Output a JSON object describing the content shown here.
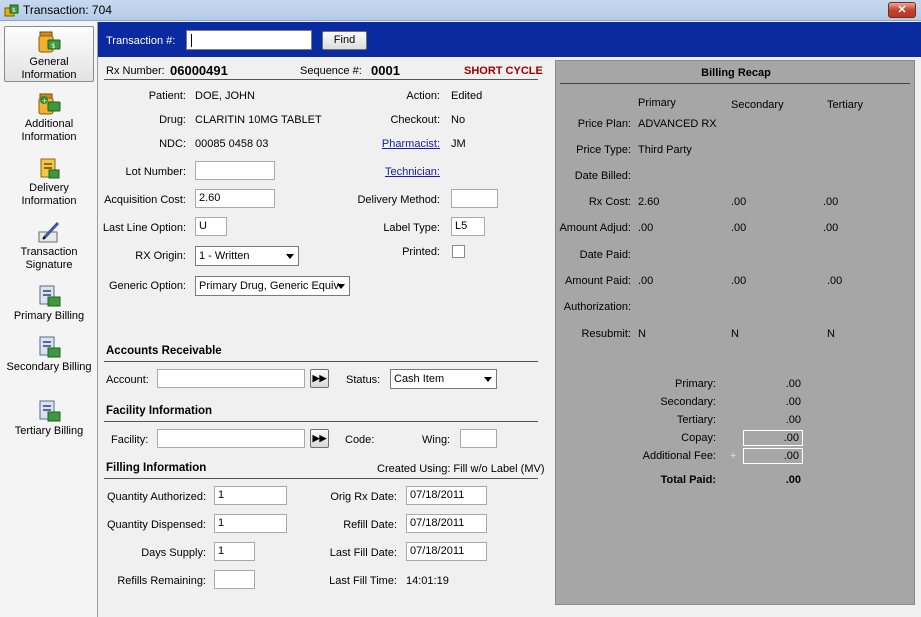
{
  "window": {
    "title": "Transaction: 704",
    "close_label": "✕"
  },
  "sidebar": {
    "items": [
      {
        "label": "General Information"
      },
      {
        "label": "Additional Information"
      },
      {
        "label": "Delivery Information"
      },
      {
        "label": "Transaction Signature"
      },
      {
        "label": "Primary Billing"
      },
      {
        "label": "Secondary Billing"
      },
      {
        "label": "Tertiary Billing"
      }
    ]
  },
  "search": {
    "label": "Transaction #:",
    "value": "",
    "find_label": "Find"
  },
  "header": {
    "rx_number_label": "Rx Number:",
    "rx_number": "06000491",
    "sequence_label": "Sequence #:",
    "sequence": "0001",
    "cycle": "SHORT CYCLE"
  },
  "rx": {
    "patient_label": "Patient:",
    "patient": "DOE, JOHN",
    "drug_label": "Drug:",
    "drug": "CLARITIN 10MG TABLET",
    "ndc_label": "NDC:",
    "ndc": "00085 0458 03",
    "lot_label": "Lot Number:",
    "lot": "",
    "acq_cost_label": "Acquisition Cost:",
    "acq_cost": "2.60",
    "last_line_label": "Last Line Option:",
    "last_line": "U",
    "origin_label": "RX Origin:",
    "origin": "1 - Written",
    "generic_label": "Generic Option:",
    "generic": "Primary Drug, Generic Equiv",
    "action_label": "Action:",
    "action": "Edited",
    "checkout_label": "Checkout:",
    "checkout": "No",
    "pharmacist_label": "Pharmacist:",
    "pharmacist": "JM",
    "technician_label": "Technician:",
    "delivery_label": "Delivery Method:",
    "delivery": "",
    "label_type_label": "Label Type:",
    "label_type": "L5",
    "printed_label": "Printed:"
  },
  "ar": {
    "title": "Accounts Receivable",
    "account_label": "Account:",
    "account": "",
    "status_label": "Status:",
    "status": "Cash Item"
  },
  "facility": {
    "title": "Facility Information",
    "facility_label": "Facility:",
    "facility": "",
    "code_label": "Code:",
    "wing_label": "Wing:",
    "wing": ""
  },
  "filling": {
    "title": "Filling Information",
    "created_using": "Created Using: Fill w/o Label (MV)",
    "qty_auth_label": "Quantity Authorized:",
    "qty_auth": "1",
    "qty_disp_label": "Quantity Dispensed:",
    "qty_disp": "1",
    "days_label": "Days Supply:",
    "days": "1",
    "refills_label": "Refills Remaining:",
    "refills": "",
    "orig_date_label": "Orig Rx Date:",
    "orig_date": "07/18/2011",
    "refill_date_label": "Refill Date:",
    "refill_date": "07/18/2011",
    "last_fill_label": "Last Fill Date:",
    "last_fill": "07/18/2011",
    "last_time_label": "Last Fill Time:",
    "last_time": "14:01:19"
  },
  "recap": {
    "title": "Billing Recap",
    "columns": [
      "Primary",
      "Secondary",
      "Tertiary"
    ],
    "rows": [
      {
        "label": "Price Plan:",
        "values": [
          "ADVANCED RX",
          "",
          ""
        ]
      },
      {
        "label": "Price Type:",
        "values": [
          "Third Party",
          "",
          ""
        ]
      },
      {
        "label": "Date Billed:",
        "values": [
          "",
          "",
          ""
        ]
      },
      {
        "label": "Rx Cost:",
        "values": [
          "2.60",
          ".00",
          ".00"
        ]
      },
      {
        "label": "Amount Adjud:",
        "values": [
          ".00",
          ".00",
          ".00"
        ]
      },
      {
        "label": "Date Paid:",
        "values": [
          "",
          "",
          ""
        ]
      },
      {
        "label": "Amount Paid:",
        "values": [
          ".00",
          ".00",
          ".00"
        ]
      },
      {
        "label": "Authorization:",
        "values": [
          "",
          "",
          ""
        ]
      },
      {
        "label": "Resubmit:",
        "values": [
          "N",
          "N",
          "N"
        ]
      }
    ],
    "totals": {
      "primary_label": "Primary:",
      "primary": ".00",
      "secondary_label": "Secondary:",
      "secondary": ".00",
      "tertiary_label": "Tertiary:",
      "tertiary": ".00",
      "copay_label": "Copay:",
      "copay": ".00",
      "fee_label": "Additional Fee:",
      "fee": ".00",
      "fee_plus": "+",
      "total_label": "Total Paid:",
      "total": ".00"
    }
  }
}
